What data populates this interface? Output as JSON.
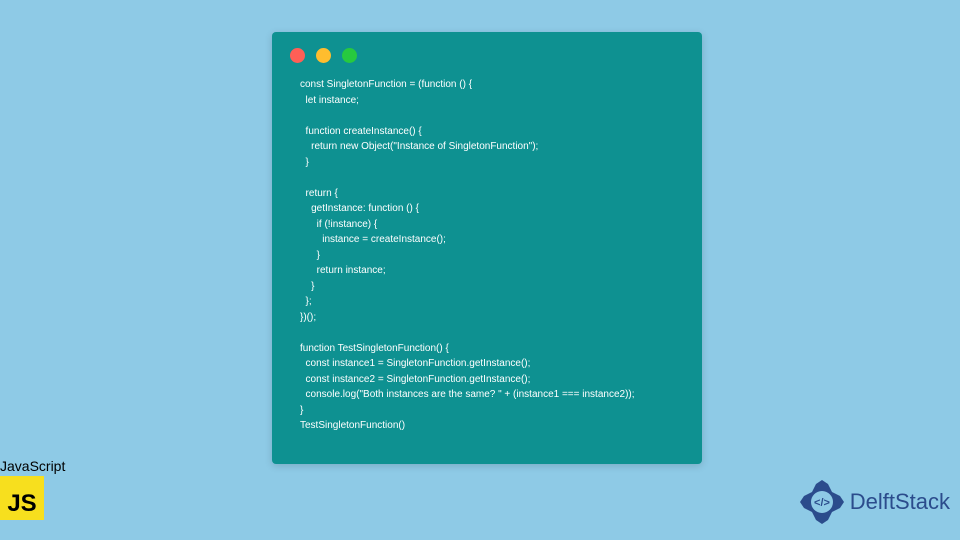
{
  "code": {
    "lines": "const SingletonFunction = (function () {\n  let instance;\n\n  function createInstance() {\n    return new Object(\"Instance of SingletonFunction\");\n  }\n\n  return {\n    getInstance: function () {\n      if (!instance) {\n        instance = createInstance();\n      }\n      return instance;\n    }\n  };\n})();\n\nfunction TestSingletonFunction() {\n  const instance1 = SingletonFunction.getInstance();\n  const instance2 = SingletonFunction.getInstance();\n  console.log(\"Both instances are the same? \" + (instance1 === instance2));\n}\nTestSingletonFunction()"
  },
  "js_badge": {
    "label": "JavaScript",
    "logo_text": "JS"
  },
  "brand": {
    "name": "DelftStack"
  },
  "colors": {
    "background": "#8ECAE6",
    "code_bg": "#0E9191",
    "js_yellow": "#F7DF1E",
    "brand_blue": "#2B4C8C"
  }
}
